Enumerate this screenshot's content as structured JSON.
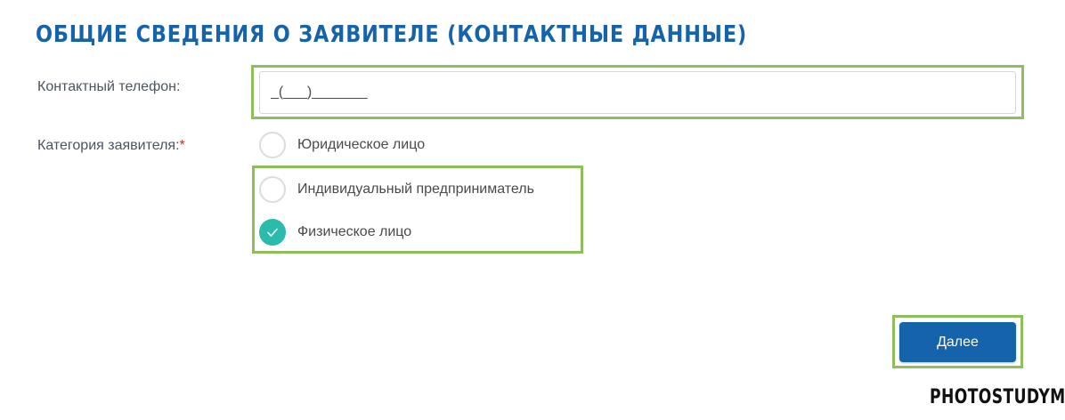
{
  "header": {
    "title": "ОБЩИЕ СВЕДЕНИЯ О ЗАЯВИТЕЛЕ (КОНТАКТНЫЕ ДАННЫЕ)"
  },
  "form": {
    "phone": {
      "label": "Контактный телефон:",
      "value": "_(___)_______"
    },
    "category": {
      "label": "Категория заявителя:",
      "required_mark": "*",
      "options": [
        {
          "label": "Юридическое лицо",
          "selected": false
        },
        {
          "label": "Индивидуальный предприниматель",
          "selected": false
        },
        {
          "label": "Физическое лицо",
          "selected": true
        }
      ]
    },
    "next_label": "Далее"
  },
  "watermark": {
    "text": "PHOTOSTUDYME"
  },
  "colors": {
    "title": "#1463ab",
    "button": "#1463ab",
    "radio_checked": "#2bbbad",
    "highlight": "#8fbf5a",
    "required": "#e0201b"
  },
  "icons": {
    "radio_check": "check-icon"
  }
}
